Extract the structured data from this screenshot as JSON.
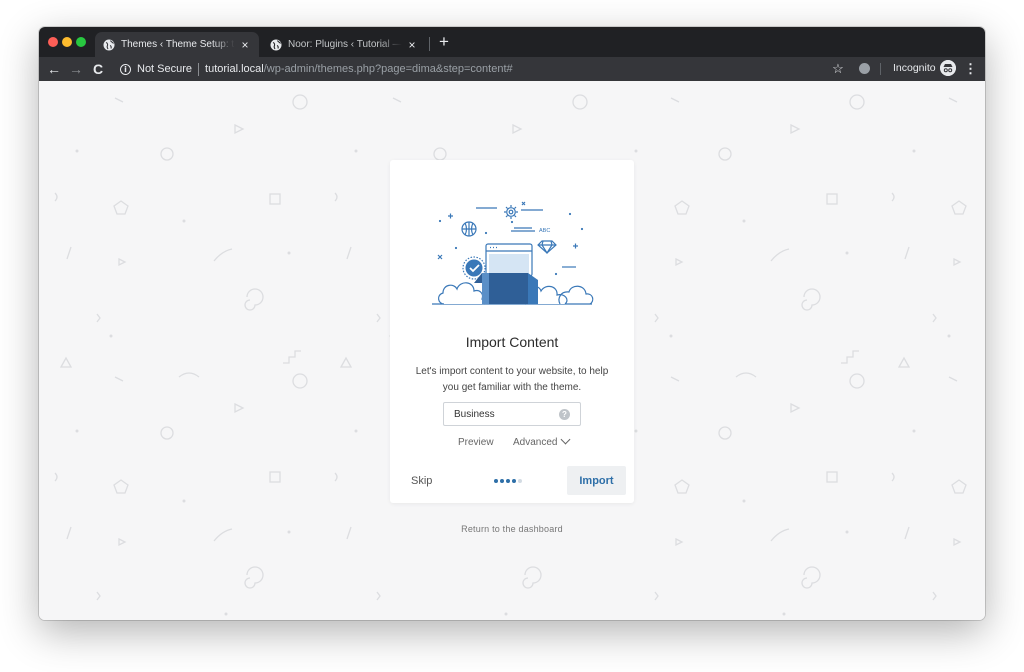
{
  "browser": {
    "tabs": [
      {
        "title": "Themes ‹ Theme Setup: tutorial",
        "close": "×"
      },
      {
        "title": "Noor: Plugins ‹ Tutorial — WordPress",
        "close": "×"
      }
    ],
    "new_tab": "+",
    "nav": {
      "back": "←",
      "forward": "→",
      "reload": "C"
    },
    "security_info": "i",
    "security_label": "Not Secure",
    "url_host": "tutorial.local",
    "url_path": "/wp-admin/themes.php?page=dima&step=content#",
    "bookmark": "☆",
    "incognito_label": "Incognito",
    "menu": "⋮"
  },
  "card": {
    "title": "Import Content",
    "description": "Let's import content to your website, to help you get familiar with the theme.",
    "select_value": "Business",
    "help": "?",
    "preview_label": "Preview",
    "advanced_label": "Advanced",
    "skip_label": "Skip",
    "import_label": "Import",
    "progress": {
      "total": 5,
      "current": 4
    },
    "illustration_text": "ABC"
  },
  "return_label": "Return to the dashboard",
  "colors": {
    "accent": "#2e6fa8",
    "illustration": "#3a78b8",
    "background": "#f6f6f7"
  }
}
